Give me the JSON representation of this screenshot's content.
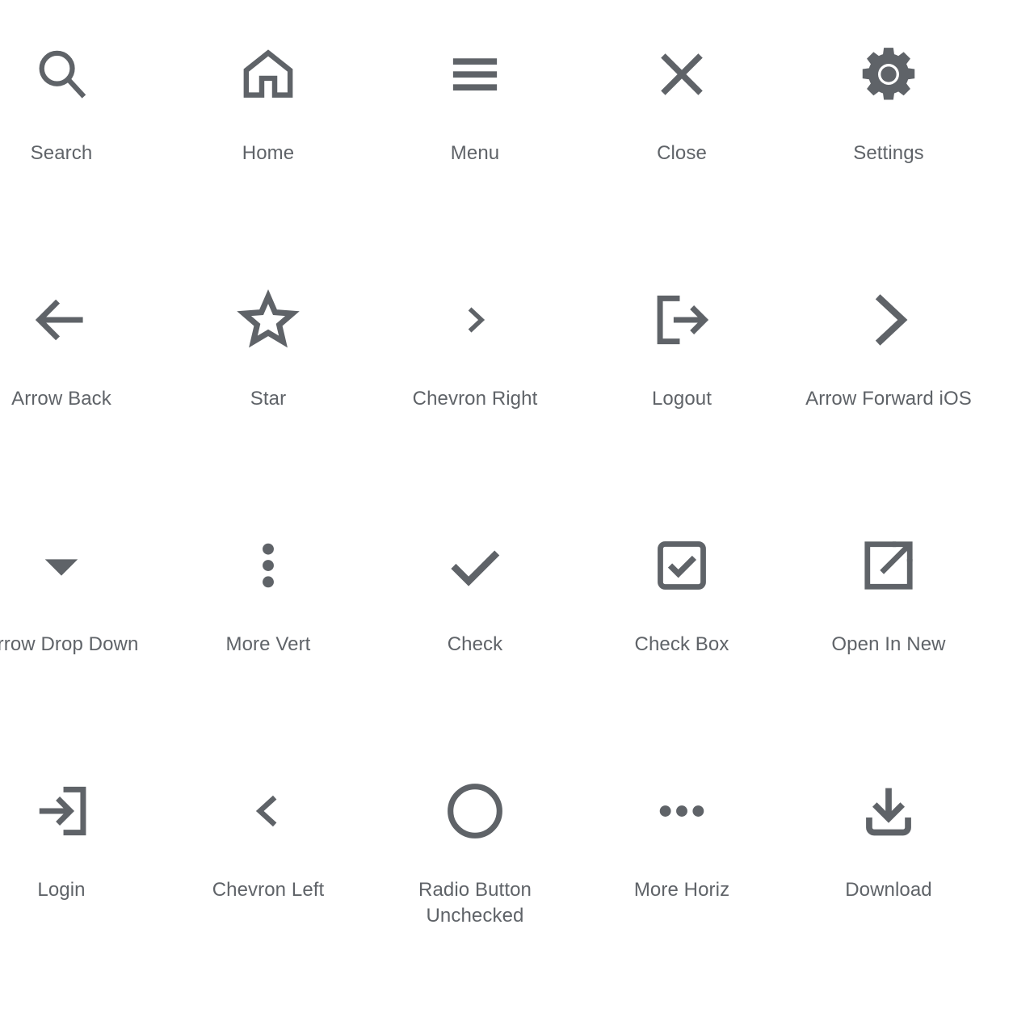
{
  "page": {
    "background_color": "#ffffff",
    "icon_color": "#5f6368",
    "label_color": "#5f6368",
    "columns": 5,
    "rows": 4
  },
  "icons": [
    {
      "name": "search-icon",
      "label": "Search"
    },
    {
      "name": "home-icon",
      "label": "Home"
    },
    {
      "name": "menu-icon",
      "label": "Menu"
    },
    {
      "name": "close-icon",
      "label": "Close"
    },
    {
      "name": "settings-icon",
      "label": "Settings"
    },
    {
      "name": "arrow-back-icon",
      "label": "Arrow Back"
    },
    {
      "name": "star-icon",
      "label": "Star"
    },
    {
      "name": "chevron-right-icon",
      "label": "Chevron Right"
    },
    {
      "name": "logout-icon",
      "label": "Logout"
    },
    {
      "name": "arrow-forward-ios-icon",
      "label": "Arrow Forward iOS"
    },
    {
      "name": "arrow-drop-down-icon",
      "label": "Arrow Drop Down"
    },
    {
      "name": "more-vert-icon",
      "label": "More Vert"
    },
    {
      "name": "check-icon",
      "label": "Check"
    },
    {
      "name": "check-box-icon",
      "label": "Check Box"
    },
    {
      "name": "open-in-new-icon",
      "label": "Open In New"
    },
    {
      "name": "login-icon",
      "label": "Login"
    },
    {
      "name": "chevron-left-icon",
      "label": "Chevron Left"
    },
    {
      "name": "radio-button-unchecked-icon",
      "label": "Radio Button Unchecked"
    },
    {
      "name": "more-horiz-icon",
      "label": "More Horiz"
    },
    {
      "name": "download-icon",
      "label": "Download"
    }
  ]
}
